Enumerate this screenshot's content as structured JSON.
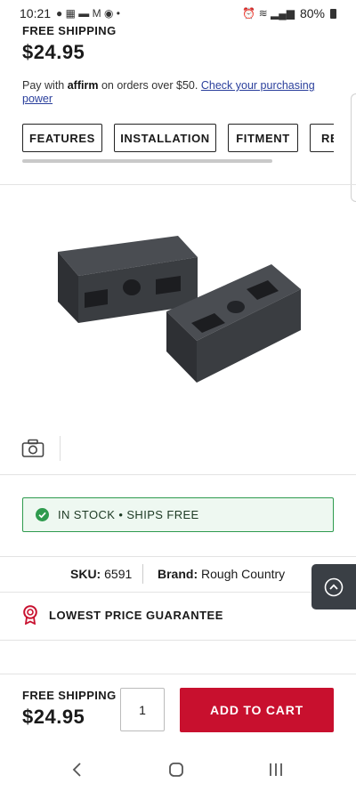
{
  "status_bar": {
    "time": "10:21",
    "battery": "80%"
  },
  "top": {
    "free_shipping": "FREE SHIPPING",
    "price": "$24.95"
  },
  "affirm": {
    "prefix": "Pay with",
    "logo": "affirm",
    "middle": "on orders over $50.",
    "link": "Check your purchasing power"
  },
  "tabs": [
    {
      "label": "FEATURES"
    },
    {
      "label": "INSTALLATION"
    },
    {
      "label": "FITMENT"
    },
    {
      "label": "RE"
    }
  ],
  "stock": {
    "text": "IN STOCK • SHIPS FREE",
    "icon": "check-circle-icon",
    "color": "#2e9b4e"
  },
  "details": {
    "sku_label": "SKU:",
    "sku_value": "6591",
    "brand_label": "Brand:",
    "brand_value": "Rough Country"
  },
  "guarantee": {
    "text": "LOWEST PRICE GUARANTEE",
    "icon": "ribbon-icon"
  },
  "bottom_bar": {
    "free_shipping": "FREE SHIPPING",
    "price": "$24.95",
    "quantity": "1",
    "add_to_cart": "ADD TO CART",
    "accent": "#c8102e"
  },
  "icons": {
    "camera": "camera-icon",
    "back_to_top": "chevron-up-icon"
  }
}
